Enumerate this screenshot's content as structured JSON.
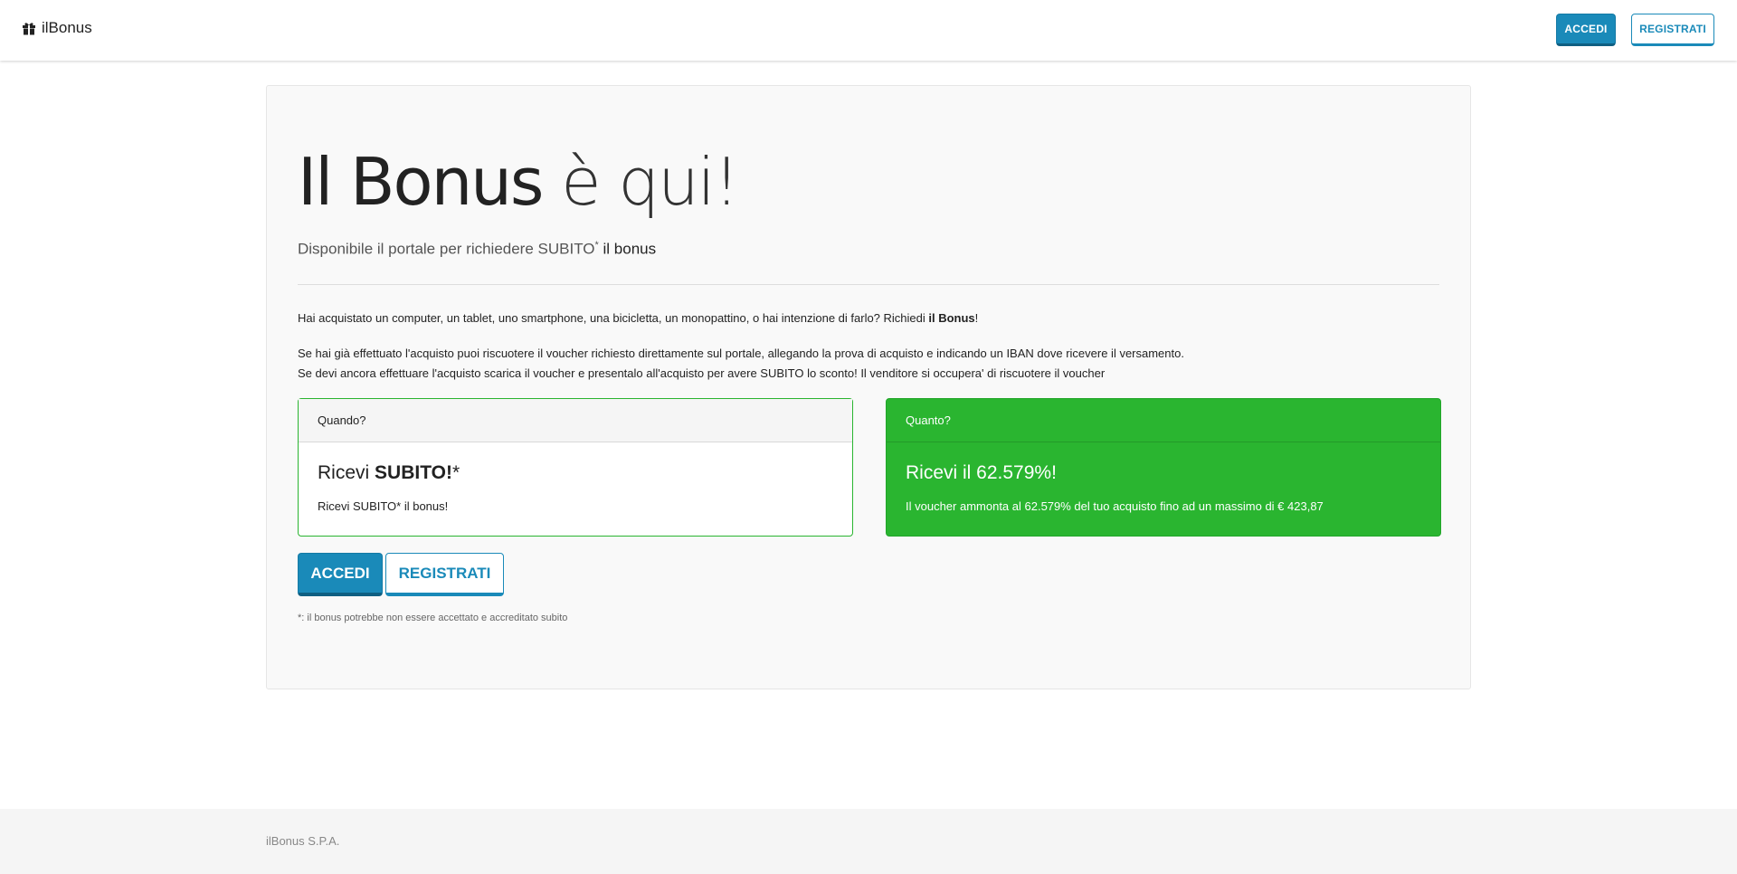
{
  "navbar": {
    "brand": "ilBonus",
    "brand_icon": "gift-icon",
    "login_label": "ACCEDI",
    "register_label": "REGISTRATI"
  },
  "hero": {
    "title_main": "Il Bonus",
    "title_light": "è qui!",
    "lead_prefix": "Disponibile il portale per richiedere SUBITO",
    "lead_asterisk": "*",
    "lead_strong": "il bonus"
  },
  "body": {
    "p1_text": "Hai acquistato un computer, un tablet, uno smartphone, una bicicletta, un monopattino, o hai intenzione di farlo? Richiedi ",
    "p1_strong": "il Bonus",
    "p1_end": "!",
    "p2": "Se hai già effettuato l'acquisto puoi riscuotere il voucher richiesto direttamente sul portale, allegando la prova di acquisto e indicando un IBAN dove ricevere il versamento.",
    "p3": "Se devi ancora effettuare l'acquisto scarica il voucher e presentalo all'acquisto per avere SUBITO lo sconto! Il venditore si occupera' di riscuotere il voucher"
  },
  "card_when": {
    "header": "Quando?",
    "title_prefix": "Ricevi ",
    "title_strong": "SUBITO!",
    "title_asterisk": "*",
    "text": "Ricevi SUBITO* il bonus!"
  },
  "card_how": {
    "header": "Quanto?",
    "title": "Ricevi il 62.579%!",
    "text": "Il voucher ammonta al 62.579% del tuo acquisto fino ad un massimo di € 423,87"
  },
  "actions": {
    "login_label": "ACCEDI",
    "register_label": "REGISTRATI"
  },
  "footnote": "*: il bonus potrebbe non essere accettato e accreditato subito",
  "footer": {
    "company": "ilBonus S.P.A."
  },
  "colors": {
    "primary": "#1a8ab9",
    "success": "#2ab530",
    "jumbotron_bg": "#f9f9f9",
    "footer_bg": "#f5f5f5"
  }
}
